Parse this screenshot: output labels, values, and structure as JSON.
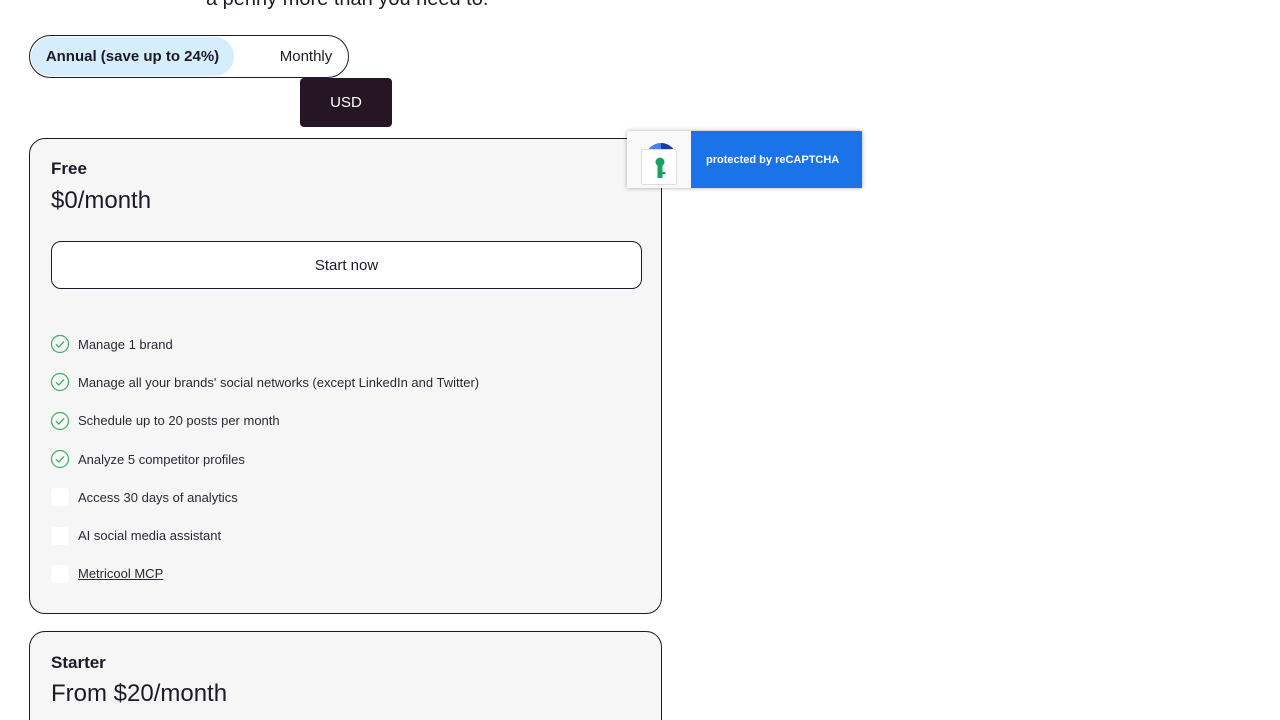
{
  "header": {
    "cut_text": "a penny more than you need to."
  },
  "billing": {
    "annual_label": "Annual (save up to 24%)",
    "monthly_label": "Monthly"
  },
  "currency": {
    "label": "USD"
  },
  "plans": [
    {
      "name": "Free",
      "price": "$0/month",
      "cta": "Start now",
      "features": [
        {
          "text": "Manage 1 brand",
          "included": true
        },
        {
          "text": "Manage all your brands' social networks (except LinkedIn and Twitter)",
          "included": true
        },
        {
          "text": "Schedule up to 20 posts per month",
          "included": true
        },
        {
          "text": "Analyze 5 competitor profiles",
          "included": true
        },
        {
          "text": "Access 30 days of analytics",
          "included": false
        },
        {
          "text": "AI social media assistant",
          "included": false
        },
        {
          "text": "Metricool MCP",
          "included": false
        }
      ]
    },
    {
      "name": "Starter",
      "price": "From $20/month"
    }
  ],
  "recaptcha": {
    "label": "protected by reCAPTCHA"
  },
  "colors": {
    "accent_dark": "#261623",
    "toggle_active": "#d6eefc",
    "check_green": "#3fae5c",
    "recaptcha_blue": "#1a73e8"
  },
  "icons": {
    "check": "check-circle-icon",
    "recaptcha": "recaptcha-logo-icon",
    "key": "key-icon"
  }
}
